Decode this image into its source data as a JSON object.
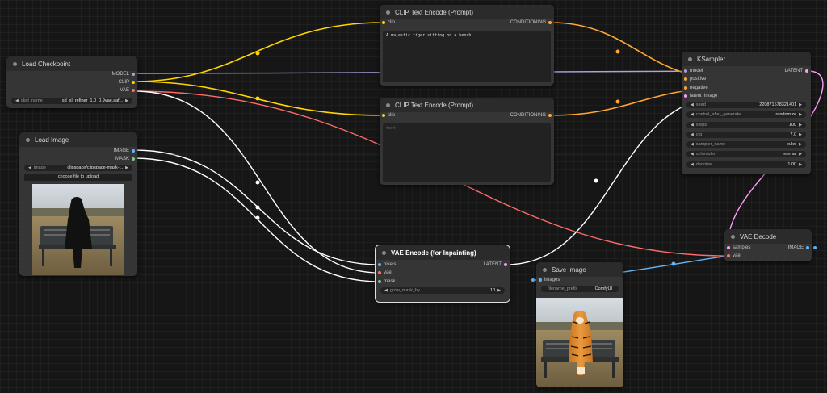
{
  "colors": {
    "clip": "#ffd500",
    "conditioning": "#ffa931",
    "model": "#b39ddb",
    "vae": "#ff6e6e",
    "latent": "#ff9cf9",
    "image": "#64b5f6",
    "mask": "#81c784",
    "white_link": "#ffffff"
  },
  "nodes": {
    "load_checkpoint": {
      "title": "Load Checkpoint",
      "outputs": [
        "MODEL",
        "CLIP",
        "VAE"
      ],
      "widget_label": "ckpt_name",
      "widget_value": "sd_xl_refiner_1.0_0.9vae.saf..."
    },
    "load_image": {
      "title": "Load Image",
      "outputs": [
        "IMAGE",
        "MASK"
      ],
      "widget_label": "image",
      "widget_value": "clipspace/clipspace-mask-...",
      "upload_label": "choose file to upload"
    },
    "clip_pos": {
      "title": "CLIP Text Encode (Prompt)",
      "input": "clip",
      "output": "CONDITIONING",
      "text": "A majestic tiger sitting on a bench"
    },
    "clip_neg": {
      "title": "CLIP Text Encode (Prompt)",
      "input": "clip",
      "output": "CONDITIONING",
      "placeholder": "text"
    },
    "vae_encode": {
      "title": "VAE Encode (for Inpainting)",
      "inputs": [
        "pixels",
        "vae",
        "mask"
      ],
      "output": "LATENT",
      "widget_label": "grow_mask_by",
      "widget_value": "10"
    },
    "ksampler": {
      "title": "KSampler",
      "inputs": [
        "model",
        "positive",
        "negative",
        "latent_image"
      ],
      "output": "LATENT",
      "widgets": [
        {
          "label": "seed",
          "value": "220871578321401"
        },
        {
          "label": "control_after_generate",
          "value": "randomize"
        },
        {
          "label": "steps",
          "value": "100"
        },
        {
          "label": "cfg",
          "value": "7.0"
        },
        {
          "label": "sampler_name",
          "value": "euler"
        },
        {
          "label": "scheduler",
          "value": "normal"
        },
        {
          "label": "denoise",
          "value": "1.00"
        }
      ]
    },
    "vae_decode": {
      "title": "VAE Decode",
      "inputs": [
        "samples",
        "vae"
      ],
      "output": "IMAGE"
    },
    "save_image": {
      "title": "Save Image",
      "input": "images",
      "widget_label": "filename_prefix",
      "widget_value": "ComfyUI"
    }
  }
}
